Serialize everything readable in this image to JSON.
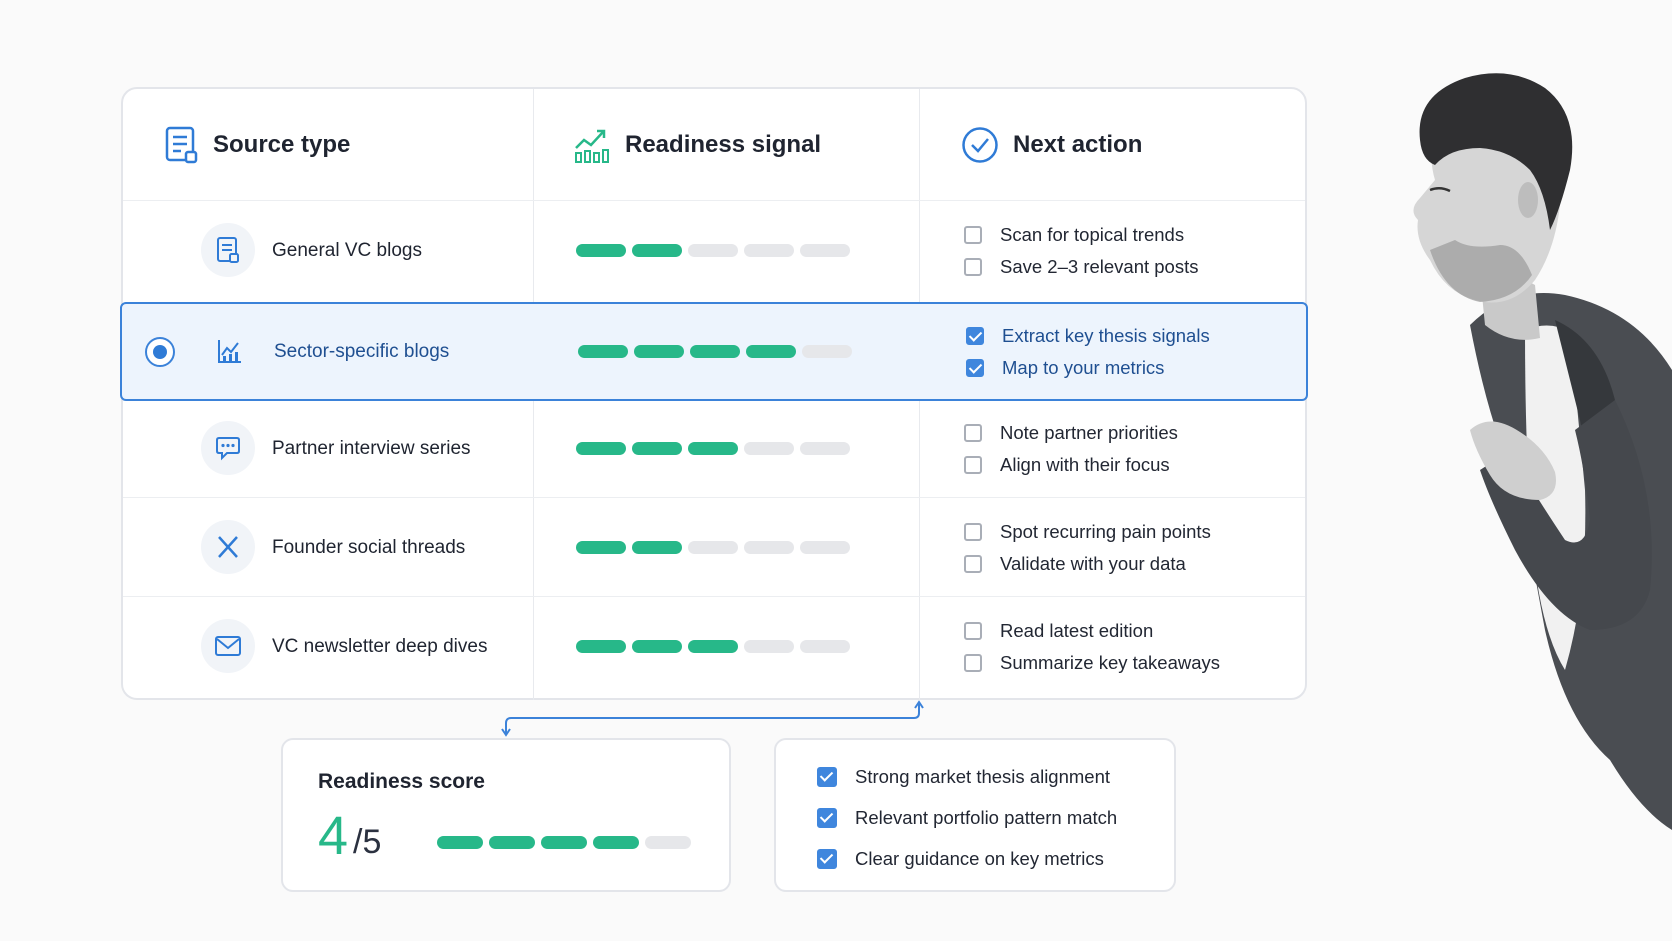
{
  "table": {
    "headers": {
      "source": {
        "label": "Source type",
        "icon": "document-icon"
      },
      "signal": {
        "label": "Readiness signal",
        "icon": "growth-chart-icon"
      },
      "action": {
        "label": "Next action",
        "icon": "check-circle-icon"
      }
    },
    "rows": [
      {
        "name": "General VC blogs",
        "icon": "document-icon",
        "readiness": 2,
        "max": 5,
        "selected": false,
        "actions": [
          {
            "label": "Scan for topical trends",
            "checked": false
          },
          {
            "label": "Save 2–3 relevant posts",
            "checked": false
          }
        ]
      },
      {
        "name": "Sector-specific blogs",
        "icon": "chart-icon",
        "readiness": 4,
        "max": 5,
        "selected": true,
        "actions": [
          {
            "label": "Extract key thesis signals",
            "checked": true
          },
          {
            "label": "Map to your metrics",
            "checked": true
          }
        ]
      },
      {
        "name": "Partner interview series",
        "icon": "chat-bubble-icon",
        "readiness": 3,
        "max": 5,
        "selected": false,
        "actions": [
          {
            "label": "Note partner priorities",
            "checked": false
          },
          {
            "label": "Align with their focus",
            "checked": false
          }
        ]
      },
      {
        "name": "Founder social threads",
        "icon": "x-logo-icon",
        "readiness": 2,
        "max": 5,
        "selected": false,
        "actions": [
          {
            "label": "Spot recurring pain points",
            "checked": false
          },
          {
            "label": "Validate with your data",
            "checked": false
          }
        ]
      },
      {
        "name": "VC newsletter deep dives",
        "icon": "envelope-icon",
        "readiness": 3,
        "max": 5,
        "selected": false,
        "actions": [
          {
            "label": "Read latest edition",
            "checked": false
          },
          {
            "label": "Summarize key takeaways",
            "checked": false
          }
        ]
      }
    ]
  },
  "score": {
    "label": "Readiness score",
    "value": "4",
    "max": "/5",
    "filled": 4,
    "total": 5
  },
  "summary": [
    {
      "label": "Strong market thesis alignment",
      "checked": true
    },
    {
      "label": "Relevant portfolio pattern match",
      "checked": true
    },
    {
      "label": "Clear guidance on key metrics",
      "checked": true
    }
  ],
  "colors": {
    "accent": "#3b82d9",
    "signal": "#27b889",
    "muted": "#e6e7ea"
  }
}
